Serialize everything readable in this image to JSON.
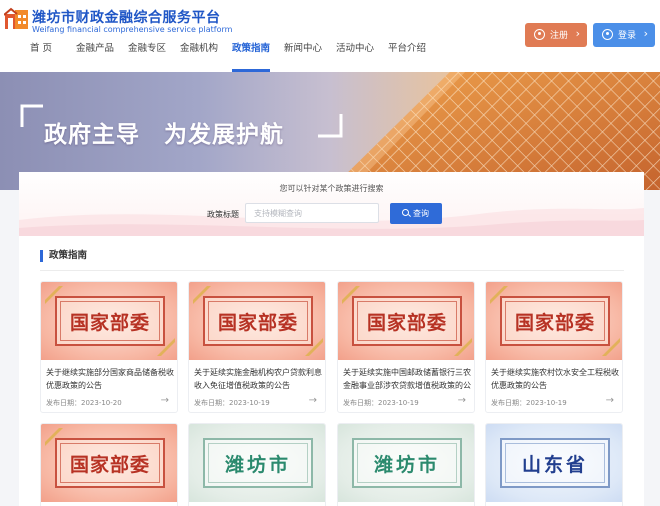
{
  "brand": {
    "title": "潍坊市财政金融综合服务平台",
    "subtitle": "Weifang financial comprehensive service platform"
  },
  "nav": [
    {
      "label": "首 页"
    },
    {
      "label": "金融产品"
    },
    {
      "label": "金融专区"
    },
    {
      "label": "金融机构"
    },
    {
      "label": "政策指南"
    },
    {
      "label": "新闻中心"
    },
    {
      "label": "活动中心"
    },
    {
      "label": "平台介绍"
    }
  ],
  "nav_active": "政策指南",
  "auth": {
    "register": "注册",
    "login": "登录"
  },
  "banner": {
    "slogan": "政府主导　为发展护航"
  },
  "search": {
    "hint": "您可以针对某个政策进行搜索",
    "label": "政策标题",
    "placeholder": "支持模糊查询",
    "value": "",
    "button": "查询"
  },
  "section": {
    "title": "政策指南"
  },
  "cards": [
    {
      "image_text": "国家部委",
      "title": "关于继续实施部分国家商品储备税收优惠政策的公告",
      "date": "发布日期：2023-10-20"
    },
    {
      "image_text": "国家部委",
      "title": "关于延续实施金融机构农户贷款利息收入免征增值税政策的公告",
      "date": "发布日期：2023-10-19"
    },
    {
      "image_text": "国家部委",
      "title": "关于延续实施中国邮政储蓄银行三农金融事业部涉农贷款增值税政策的公告",
      "date": "发布日期：2023-10-19"
    },
    {
      "image_text": "国家部委",
      "title": "关于继续实施农村饮水安全工程税收优惠政策的公告",
      "date": "发布日期：2023-10-19"
    },
    {
      "image_text": "国家部委",
      "title": "",
      "date": ""
    },
    {
      "image_text": "潍坊市",
      "title": "",
      "date": ""
    },
    {
      "image_text": "潍坊市",
      "title": "",
      "date": ""
    },
    {
      "image_text": "山东省",
      "title": "",
      "date": ""
    }
  ],
  "colors": {
    "primary": "#2d68d8",
    "register": "#e07b54",
    "login": "#4b8fe8",
    "plaque_red": "#b73224"
  },
  "icons": {
    "register": "user-circle-icon",
    "login": "user-circle-icon",
    "search": "search-icon",
    "arrow": "arrow-right-icon"
  }
}
